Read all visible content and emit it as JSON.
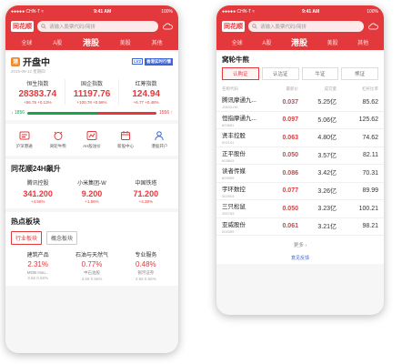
{
  "left": {
    "status": {
      "carrier": "●●●●● CHN-T ≈",
      "time": "9:41 AM",
      "battery": "100%"
    },
    "app_logo": "同花顺",
    "search_placeholder": "请输入股票代码/简拼",
    "tabs": [
      "全球",
      "A股",
      "港股",
      "美股",
      "其他"
    ],
    "active_tab_index": 2,
    "open": {
      "badge": "港",
      "title": "开盘中",
      "date": "2019-09-12 星期四",
      "tag1": "LV2",
      "tag2": "香港实时行情"
    },
    "indices": [
      {
        "name": "恒生指数",
        "value": "28383.74",
        "change": "+56.75  +0.13%"
      },
      {
        "name": "国企指数",
        "value": "11197.76",
        "change": "+100.78  +0.56%"
      },
      {
        "name": "红筹指数",
        "value": "124.94",
        "change": "+6.77  +0.48%"
      }
    ],
    "flow": {
      "down": "↓ 1856",
      "up": "1556 ↑",
      "down_ratio": 0.54
    },
    "quick": [
      {
        "icon": "link-icon",
        "label": "沪深港通"
      },
      {
        "icon": "bull-icon",
        "label": "窝轮牛熊"
      },
      {
        "icon": "ah-icon",
        "label": "AH股溢价"
      },
      {
        "icon": "calendar-icon",
        "label": "新股中心"
      },
      {
        "icon": "person-icon",
        "label": "港股开户"
      }
    ],
    "hot_title": "同花顺24H飙升",
    "hot": [
      {
        "name": "腾讯控股",
        "price": "341.200",
        "change": "+4.56%"
      },
      {
        "name": "小米集团-W",
        "price": "9.200",
        "change": "+1.56%"
      },
      {
        "name": "中国铁塔",
        "price": "71.200",
        "change": "+4.38%"
      }
    ],
    "sector_title": "热点板块",
    "sector_tabs": [
      "行业板块",
      "概念板块"
    ],
    "sectors": [
      {
        "name": "建筑产品",
        "pct": "2.31%",
        "leader": "MOB Hou...",
        "extra": "3.56  0.56%"
      },
      {
        "name": "石油与天然气",
        "pct": "0.77%",
        "leader": "中石油股",
        "extra": "3.56  0.56%"
      },
      {
        "name": "专业服务",
        "pct": "0.48%",
        "leader": "银河证券",
        "extra": "3.56  0.56%"
      }
    ]
  },
  "right": {
    "status": {
      "carrier": "●●●●● CHN-T ≈",
      "time": "9:41 AM",
      "battery": "100%"
    },
    "app_logo": "同花顺",
    "search_placeholder": "请输入股票代码/简拼",
    "tabs": [
      "全球",
      "A股",
      "港股",
      "美股",
      "其他"
    ],
    "title": "窝轮牛熊",
    "segments": [
      "认购证",
      "认沽证",
      "牛证",
      "熊证"
    ],
    "headers": [
      "名称代码",
      "最新价",
      "成交量",
      "杠杆比率"
    ],
    "rows": [
      {
        "name": "腾讯摩通九...",
        "code": "19633.HK",
        "price": "0.037",
        "amount": "5.25亿",
        "lev": "85.62"
      },
      {
        "name": "恒指摩通九...",
        "code": "603681",
        "price": "0.097",
        "amount": "5.06亿",
        "lev": "125.62"
      },
      {
        "name": "贤丰控股",
        "code": "002141",
        "price": "0.063",
        "amount": "4.80亿",
        "lev": "74.62"
      },
      {
        "name": "正平股份",
        "code": "603843",
        "price": "0.050",
        "amount": "3.57亿",
        "lev": "82.11"
      },
      {
        "name": "读者传媒",
        "code": "603999",
        "price": "0.086",
        "amount": "3.42亿",
        "lev": "70.31"
      },
      {
        "name": "宇环数控",
        "code": "002903",
        "price": "0.077",
        "amount": "3.26亿",
        "lev": "89.99"
      },
      {
        "name": "三只松鼠",
        "code": "300783",
        "price": "0.050",
        "amount": "3.23亿",
        "lev": "100.21"
      },
      {
        "name": "亚威股份",
        "code": "002559",
        "price": "0.061",
        "amount": "3.21亿",
        "lev": "98.21"
      }
    ],
    "more": "更多 ›",
    "feedback": "意见反馈"
  },
  "colors": {
    "brand_red": "#e4393c",
    "down_green": "#1aa34a",
    "link_blue": "#3a64d8"
  }
}
